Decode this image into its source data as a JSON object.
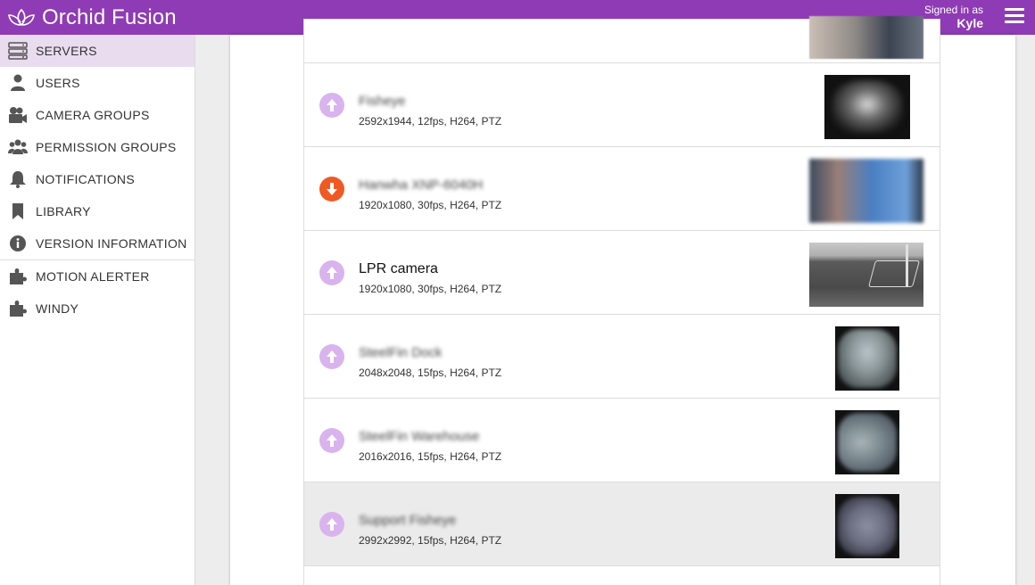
{
  "header": {
    "app_name": "Orchid Fusion",
    "signed_in_label": "Signed in as",
    "user_name": "Kyle",
    "accent_color": "#8e3bb5"
  },
  "sidebar": {
    "items": [
      {
        "label": "SERVERS",
        "icon": "server-icon",
        "active": true
      },
      {
        "label": "USERS",
        "icon": "user-icon"
      },
      {
        "label": "CAMERA GROUPS",
        "icon": "camera-icon"
      },
      {
        "label": "PERMISSION GROUPS",
        "icon": "group-icon"
      },
      {
        "label": "NOTIFICATIONS",
        "icon": "bell-icon"
      },
      {
        "label": "LIBRARY",
        "icon": "bookmark-icon"
      },
      {
        "label": "VERSION INFORMATION",
        "icon": "info-icon"
      },
      {
        "label": "MOTION ALERTER",
        "icon": "puzzle-icon"
      },
      {
        "label": "WINDY",
        "icon": "puzzle-icon"
      }
    ]
  },
  "cameras": [
    {
      "name": "",
      "spec": "",
      "status": "online"
    },
    {
      "name": "Fisheye",
      "spec": "2592x1944, 12fps, H264, PTZ",
      "status": "online",
      "name_blurred": true
    },
    {
      "name": "Hanwha XNP-6040H",
      "spec": "1920x1080, 30fps, H264, PTZ",
      "status": "offline",
      "name_blurred": true
    },
    {
      "name": "LPR camera",
      "spec": "1920x1080, 30fps, H264, PTZ",
      "status": "online"
    },
    {
      "name": "SteelFin Dock",
      "spec": "2048x2048, 15fps, H264, PTZ",
      "status": "online",
      "name_blurred": true
    },
    {
      "name": "SteelFin Warehouse",
      "spec": "2016x2016, 15fps, H264, PTZ",
      "status": "online",
      "name_blurred": true
    },
    {
      "name": "Support Fisheye",
      "spec": "2992x2992, 15fps, H264, PTZ",
      "status": "online",
      "name_blurred": true,
      "selected": true
    }
  ]
}
